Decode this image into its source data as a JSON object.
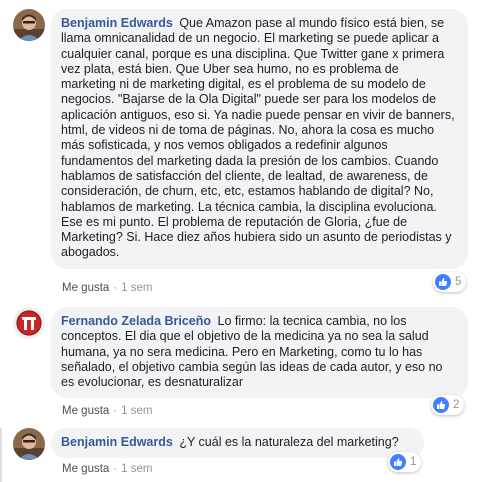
{
  "comments": [
    {
      "author": "Benjamin Edwards",
      "text": "Que Amazon pase al mundo físico está bien, se llama omnicanalidad de un negocio. El marketing se puede aplicar a cualquier canal, porque es una disciplina. Que Twitter gane x primera vez plata, está bien. Que Uber sea humo, no es problema de marketing ni de marketing digital, es el problema de su modelo de negocios. \"Bajarse de la Ola Digital\" puede ser para los modelos de aplicación antiguos, eso si. Ya nadie puede pensar en vivir de banners, html, de videos ni de toma de páginas. No, ahora la cosa es mucho más sofisticada, y nos vemos obligados a redefinir algunos fundamentos del marketing dada la presión de los cambios. Cuando hablamos de satisfacción del cliente, de lealtad, de awareness, de consideración, de churn, etc, etc, estamos hablando de digital? No, hablamos de marketing. La técnica cambia, la disciplina evoluciona. Ese es mi punto. El problema de reputación de Gloria, ¿fue de Marketing? Si. Hace diez años hubiera sido un asunto de periodistas y abogados.",
      "like_label": "Me gusta",
      "time": "1 sem",
      "reaction_count": "5",
      "avatar": "person-avatar"
    },
    {
      "author": "Fernando Zelada Briceño",
      "text": "Lo firmo: la tecnica cambia, no los conceptos. El dia que el objetivo de la medicina ya no sea la salud humana, ya no sera medicina. Pero en Marketing, como tu lo has señalado, el objetivo cambia según las ideas de cada autor, y eso no es evolucionar, es desnaturalizar",
      "like_label": "Me gusta",
      "time": "1 sem",
      "reaction_count": "2",
      "avatar": "logo-avatar"
    },
    {
      "author": "Benjamin Edwards",
      "text": "¿Y cuál es la naturaleza del marketing?",
      "like_label": "Me gusta",
      "time": "1 sem",
      "reaction_count": "1",
      "avatar": "person-avatar"
    }
  ],
  "separator": "·",
  "colors": {
    "author": "#385898",
    "bubble": "#f2f3f5",
    "like_blue": "#4080ff",
    "meta": "#90949c"
  }
}
